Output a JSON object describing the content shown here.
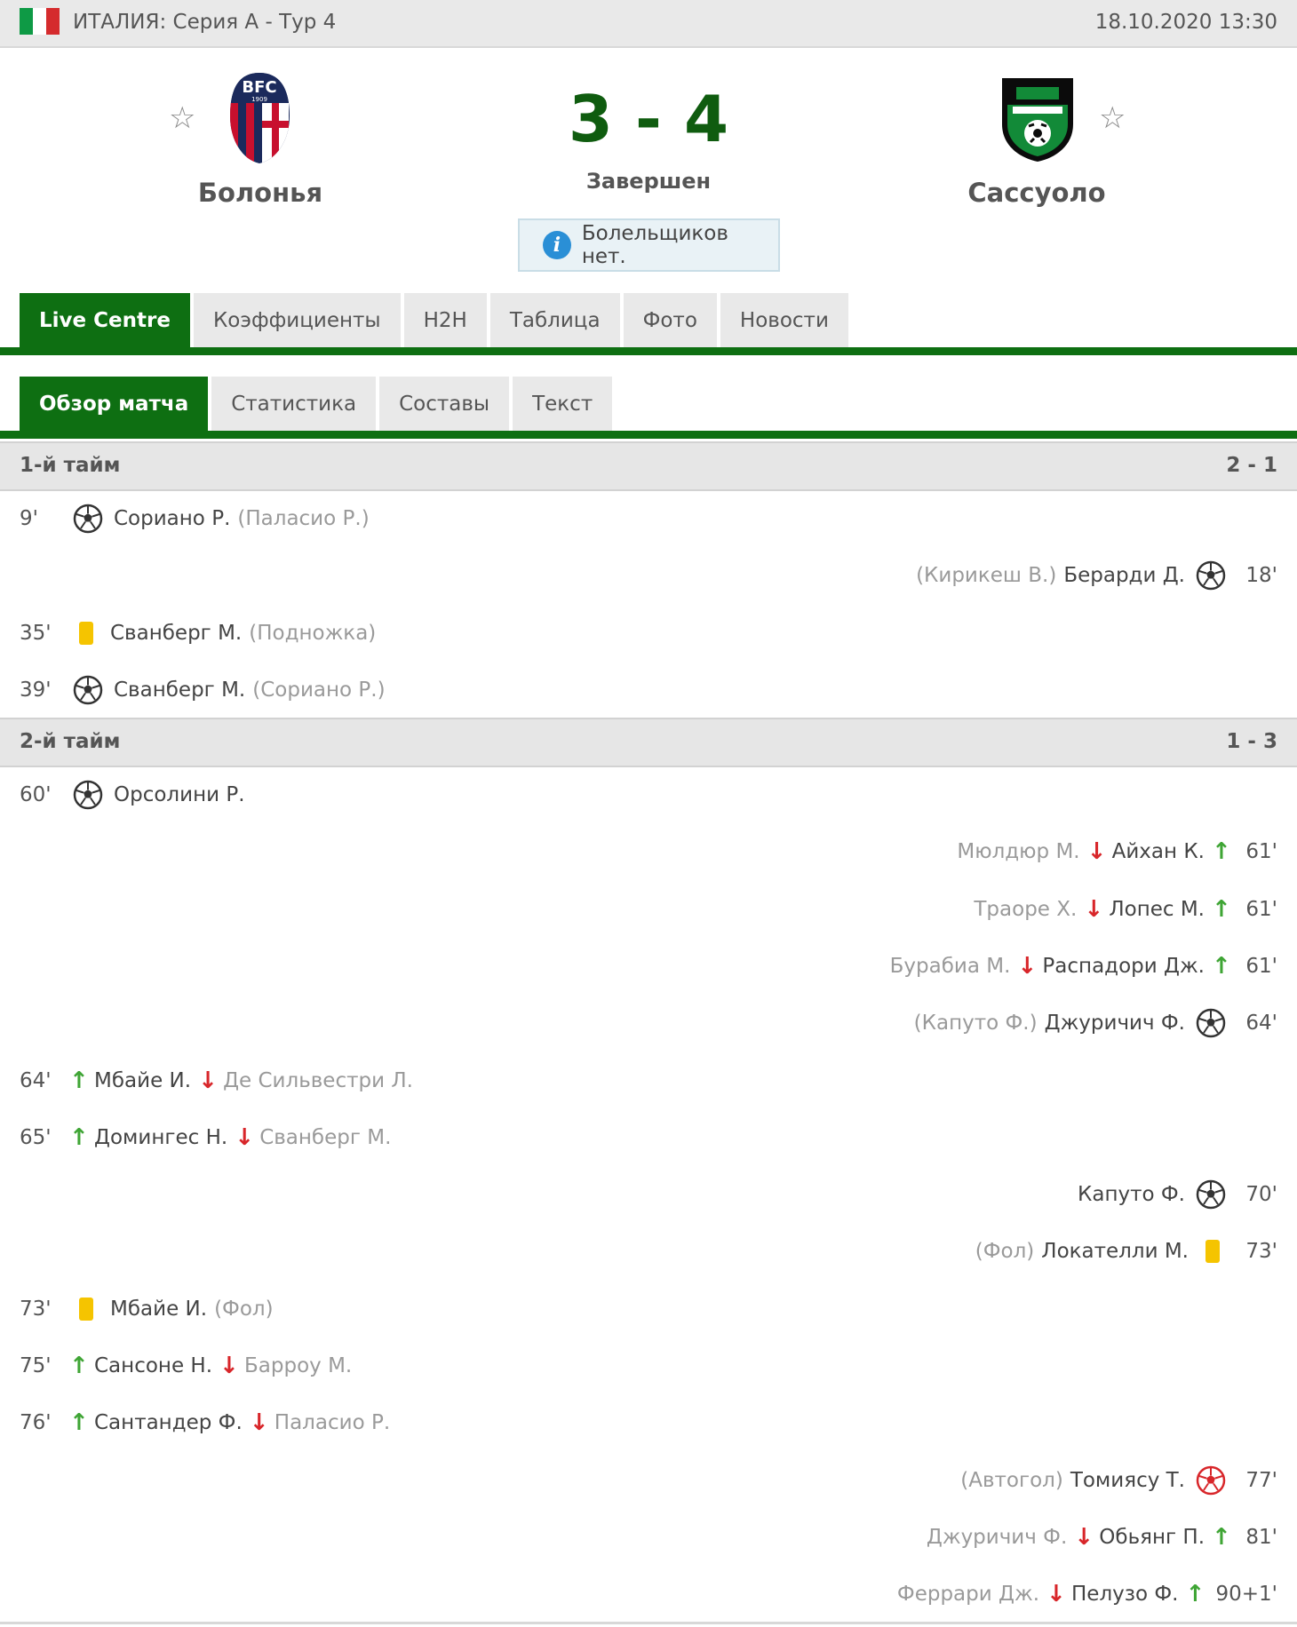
{
  "header": {
    "league": "ИТАЛИЯ: Серия А - Тур 4",
    "datetime": "18.10.2020 13:30",
    "flag_colors": [
      "#0e9a45",
      "#ffffff",
      "#d52b2d"
    ]
  },
  "match": {
    "home_team": "Болонья",
    "away_team": "Сассуоло",
    "score": "3 - 4",
    "status": "Завершен",
    "info": "Болельщиков нет.",
    "home_logo": "bologna-crest-icon",
    "away_logo": "sassuolo-crest-icon"
  },
  "tabs": [
    {
      "label": "Live Centre",
      "active": true
    },
    {
      "label": "Коэффициенты",
      "active": false
    },
    {
      "label": "H2H",
      "active": false
    },
    {
      "label": "Таблица",
      "active": false
    },
    {
      "label": "Фото",
      "active": false
    },
    {
      "label": "Новости",
      "active": false
    }
  ],
  "subtabs": [
    {
      "label": "Обзор матча",
      "active": true
    },
    {
      "label": "Статистика",
      "active": false
    },
    {
      "label": "Составы",
      "active": false
    },
    {
      "label": "Текст",
      "active": false
    }
  ],
  "periods": [
    {
      "name": "1-й тайм",
      "score": "2 - 1"
    },
    {
      "name": "2-й тайм",
      "score": "1 - 3"
    }
  ],
  "events_first_half": [
    {
      "side": "home",
      "minute": "9'",
      "type": "goal",
      "player": "Сориано Р.",
      "detail": "(Паласио Р.)"
    },
    {
      "side": "away",
      "minute": "18'",
      "type": "goal",
      "player": "Берарди Д.",
      "detail": "(Кирикеш В.)"
    },
    {
      "side": "home",
      "minute": "35'",
      "type": "yellow",
      "player": "Сванберг М.",
      "detail": "(Подножка)"
    },
    {
      "side": "home",
      "minute": "39'",
      "type": "goal",
      "player": "Сванберг М.",
      "detail": "(Сориано Р.)"
    }
  ],
  "events_second_half": [
    {
      "side": "home",
      "minute": "60'",
      "type": "goal",
      "player": "Орсолини Р.",
      "detail": ""
    },
    {
      "side": "away",
      "minute": "61'",
      "type": "sub",
      "player_in": "Айхан К.",
      "player_out": "Мюлдюр М."
    },
    {
      "side": "away",
      "minute": "61'",
      "type": "sub",
      "player_in": "Лопес М.",
      "player_out": "Траоре Х."
    },
    {
      "side": "away",
      "minute": "61'",
      "type": "sub",
      "player_in": "Распадори Дж.",
      "player_out": "Бурабиа М."
    },
    {
      "side": "away",
      "minute": "64'",
      "type": "goal",
      "player": "Джуричич Ф.",
      "detail": "(Капуто Ф.)"
    },
    {
      "side": "home",
      "minute": "64'",
      "type": "sub",
      "player_in": "Мбайе И.",
      "player_out": "Де Сильвестри Л."
    },
    {
      "side": "home",
      "minute": "65'",
      "type": "sub",
      "player_in": "Домингес Н.",
      "player_out": "Сванберг М."
    },
    {
      "side": "away",
      "minute": "70'",
      "type": "goal",
      "player": "Капуто Ф.",
      "detail": ""
    },
    {
      "side": "away",
      "minute": "73'",
      "type": "yellow",
      "player": "Локателли М.",
      "detail": "(Фол)"
    },
    {
      "side": "home",
      "minute": "73'",
      "type": "yellow",
      "player": "Мбайе И.",
      "detail": "(Фол)"
    },
    {
      "side": "home",
      "minute": "75'",
      "type": "sub",
      "player_in": "Сансоне Н.",
      "player_out": "Барроу М."
    },
    {
      "side": "home",
      "minute": "76'",
      "type": "sub",
      "player_in": "Сантандер Ф.",
      "player_out": "Паласио Р."
    },
    {
      "side": "away",
      "minute": "77'",
      "type": "owngoal",
      "player": "Томиясу Т.",
      "detail": "(Автогол)"
    },
    {
      "side": "away",
      "minute": "81'",
      "type": "sub",
      "player_in": "Обьянг П.",
      "player_out": "Джуричич Ф."
    },
    {
      "side": "away",
      "minute": "90+1'",
      "type": "sub",
      "player_in": "Пелузо Ф.",
      "player_out": "Феррари Дж."
    }
  ],
  "icons": {
    "star": "star-outline-icon",
    "info": "info-icon",
    "goal": "soccer-ball-icon",
    "owngoal": "own-goal-ball-icon",
    "yellow": "yellow-card-icon",
    "sub_in": "arrow-up-green-icon",
    "sub_out": "arrow-down-red-icon"
  }
}
